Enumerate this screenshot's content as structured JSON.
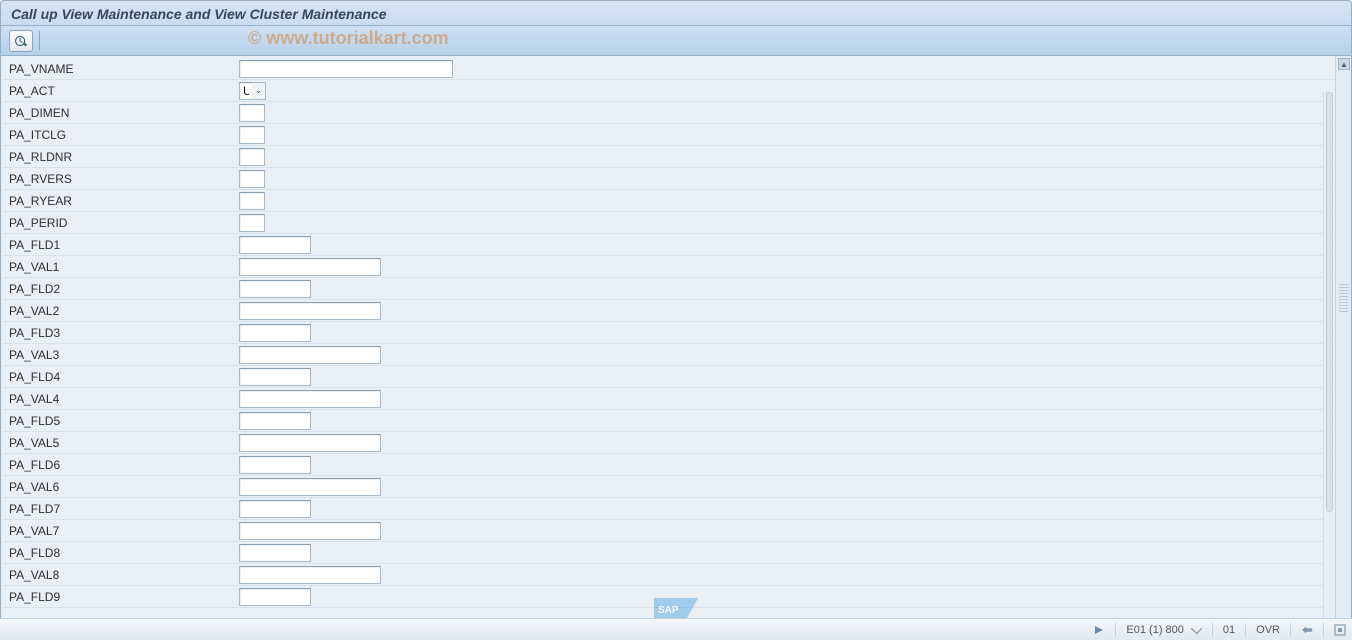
{
  "header": {
    "title": "Call up View Maintenance and View Cluster Maintenance"
  },
  "watermark": "© www.tutorialkart.com",
  "toolbar": {
    "execute_icon": "clock-check-icon"
  },
  "form": {
    "rows": [
      {
        "label": "PA_VNAME",
        "width": "w-large",
        "value": ""
      },
      {
        "label": "PA_ACT",
        "width": "w-tiny",
        "value": "U",
        "f4": true
      },
      {
        "label": "PA_DIMEN",
        "width": "w-small",
        "value": ""
      },
      {
        "label": "PA_ITCLG",
        "width": "w-small",
        "value": ""
      },
      {
        "label": "PA_RLDNR",
        "width": "w-small",
        "value": ""
      },
      {
        "label": "PA_RVERS",
        "width": "w-small",
        "value": ""
      },
      {
        "label": "PA_RYEAR",
        "width": "w-small",
        "value": ""
      },
      {
        "label": "PA_PERID",
        "width": "w-small",
        "value": ""
      },
      {
        "label": "PA_FLD1",
        "width": "w-fld",
        "value": ""
      },
      {
        "label": "PA_VAL1",
        "width": "w-val",
        "value": ""
      },
      {
        "label": "PA_FLD2",
        "width": "w-fld",
        "value": ""
      },
      {
        "label": "PA_VAL2",
        "width": "w-val",
        "value": ""
      },
      {
        "label": "PA_FLD3",
        "width": "w-fld",
        "value": ""
      },
      {
        "label": "PA_VAL3",
        "width": "w-val",
        "value": ""
      },
      {
        "label": "PA_FLD4",
        "width": "w-fld",
        "value": ""
      },
      {
        "label": "PA_VAL4",
        "width": "w-val",
        "value": ""
      },
      {
        "label": "PA_FLD5",
        "width": "w-fld",
        "value": ""
      },
      {
        "label": "PA_VAL5",
        "width": "w-val",
        "value": ""
      },
      {
        "label": "PA_FLD6",
        "width": "w-fld",
        "value": ""
      },
      {
        "label": "PA_VAL6",
        "width": "w-val",
        "value": ""
      },
      {
        "label": "PA_FLD7",
        "width": "w-fld",
        "value": ""
      },
      {
        "label": "PA_VAL7",
        "width": "w-val",
        "value": ""
      },
      {
        "label": "PA_FLD8",
        "width": "w-fld",
        "value": ""
      },
      {
        "label": "PA_VAL8",
        "width": "w-val",
        "value": ""
      },
      {
        "label": "PA_FLD9",
        "width": "w-fld",
        "value": ""
      }
    ]
  },
  "status": {
    "session": "E01 (1) 800",
    "other": "01",
    "mode": "OVR"
  }
}
